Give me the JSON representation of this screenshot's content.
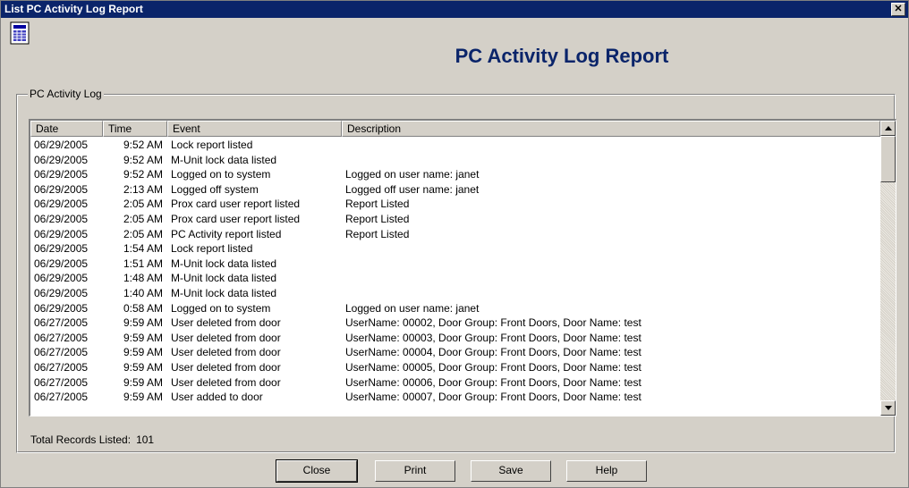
{
  "window": {
    "title": "List PC Activity Log Report",
    "close_glyph": "✕"
  },
  "header": {
    "title": "PC Activity Log Report",
    "icon": "report-icon"
  },
  "group": {
    "label": "PC Activity Log"
  },
  "list": {
    "columns": [
      "Date",
      "Time",
      "Event",
      "Description"
    ],
    "rows": [
      [
        "06/29/2005",
        "9:52 AM",
        "Lock report listed",
        ""
      ],
      [
        "06/29/2005",
        "9:52 AM",
        "M-Unit lock data listed",
        ""
      ],
      [
        "06/29/2005",
        "9:52 AM",
        "Logged on to system",
        "Logged on user name: janet"
      ],
      [
        "06/29/2005",
        "2:13 AM",
        "Logged off system",
        "Logged off user name: janet"
      ],
      [
        "06/29/2005",
        "2:05 AM",
        "Prox card user report listed",
        "Report Listed"
      ],
      [
        "06/29/2005",
        "2:05 AM",
        "Prox card user report listed",
        "Report Listed"
      ],
      [
        "06/29/2005",
        "2:05 AM",
        "PC Activity report listed",
        "Report Listed"
      ],
      [
        "06/29/2005",
        "1:54 AM",
        "Lock report listed",
        ""
      ],
      [
        "06/29/2005",
        "1:51 AM",
        "M-Unit lock data listed",
        ""
      ],
      [
        "06/29/2005",
        "1:48 AM",
        "M-Unit lock data listed",
        ""
      ],
      [
        "06/29/2005",
        "1:40 AM",
        "M-Unit lock data listed",
        ""
      ],
      [
        "06/29/2005",
        "0:58 AM",
        "Logged on to system",
        "Logged on user name: janet"
      ],
      [
        "06/27/2005",
        "9:59 AM",
        "User deleted from door",
        "UserName:  00002, Door Group: Front Doors, Door Name: test"
      ],
      [
        "06/27/2005",
        "9:59 AM",
        "User deleted from door",
        "UserName:  00003, Door Group: Front Doors, Door Name: test"
      ],
      [
        "06/27/2005",
        "9:59 AM",
        "User deleted from door",
        "UserName:  00004, Door Group: Front Doors, Door Name: test"
      ],
      [
        "06/27/2005",
        "9:59 AM",
        "User deleted from door",
        "UserName:  00005, Door Group: Front Doors, Door Name: test"
      ],
      [
        "06/27/2005",
        "9:59 AM",
        "User deleted from door",
        "UserName:  00006, Door Group: Front Doors, Door Name: test"
      ],
      [
        "06/27/2005",
        "9:59 AM",
        "User added to door",
        "UserName:  00007, Door Group: Front Doors, Door Name: test"
      ]
    ]
  },
  "total": {
    "label": "Total Records Listed:",
    "value": "101"
  },
  "buttons": {
    "close": "Close",
    "print": "Print",
    "save": "Save",
    "help": "Help"
  }
}
